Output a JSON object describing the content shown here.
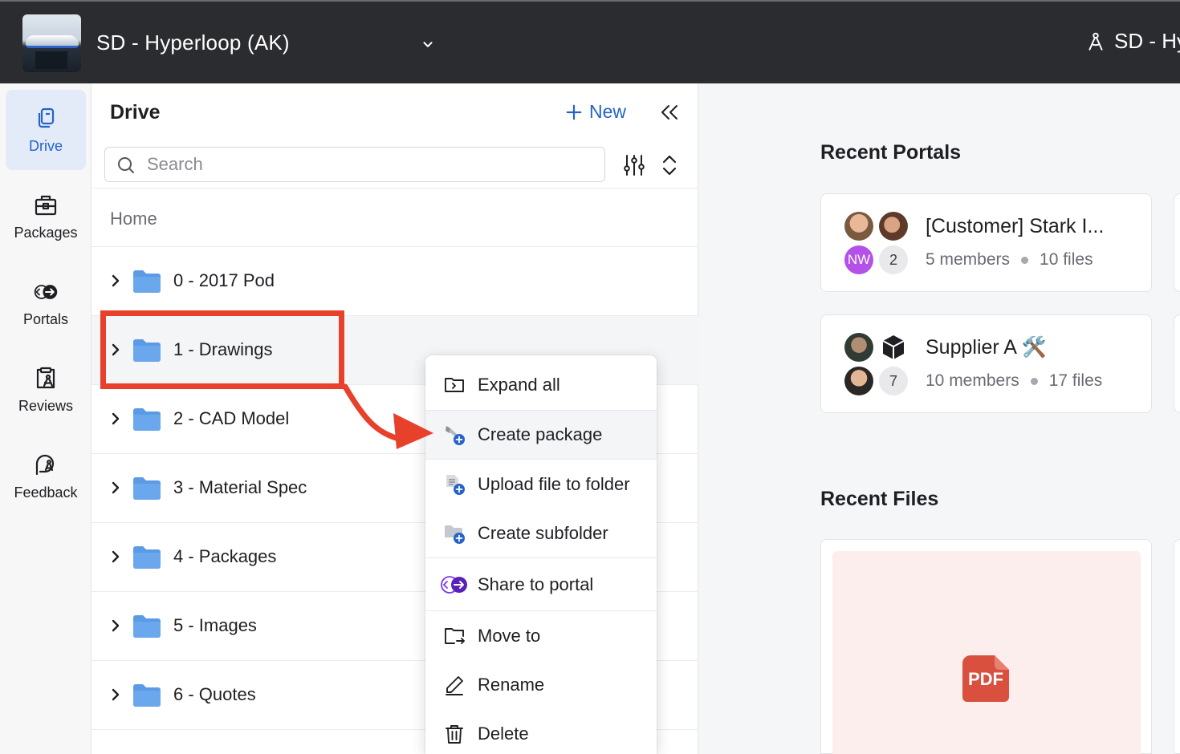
{
  "topbar": {
    "project_title": "SD - Hyperloop (AK)",
    "user_label": "SD - Hy"
  },
  "rail": {
    "items": [
      {
        "label": "Drive",
        "icon": "drive-icon",
        "active": true
      },
      {
        "label": "Packages",
        "icon": "package-icon"
      },
      {
        "label": "Portals",
        "icon": "portal-icon"
      },
      {
        "label": "Reviews",
        "icon": "review-icon"
      },
      {
        "label": "Feedback",
        "icon": "feedback-icon"
      }
    ]
  },
  "drive": {
    "title": "Drive",
    "new_label": "New",
    "search_placeholder": "Search",
    "breadcrumb": "Home",
    "folders": [
      {
        "name": "0 - 2017 Pod"
      },
      {
        "name": "1 - Drawings"
      },
      {
        "name": "2 - CAD Model"
      },
      {
        "name": "3 - Material Spec"
      },
      {
        "name": "4 - Packages"
      },
      {
        "name": "5 - Images"
      },
      {
        "name": "6 - Quotes"
      }
    ]
  },
  "context_menu": {
    "items": [
      {
        "label": "Expand all",
        "icon": "expand-folder-icon"
      },
      {
        "label": "Create package",
        "icon": "create-package-icon"
      },
      {
        "label": "Upload file to folder",
        "icon": "upload-file-icon"
      },
      {
        "label": "Create subfolder",
        "icon": "create-subfolder-icon"
      },
      {
        "label": "Share to portal",
        "icon": "share-portal-icon"
      },
      {
        "label": "Move to",
        "icon": "move-folder-icon"
      },
      {
        "label": "Rename",
        "icon": "pencil-icon"
      },
      {
        "label": "Delete",
        "icon": "trash-icon"
      }
    ]
  },
  "recent_portals": {
    "title": "Recent Portals",
    "cards": [
      {
        "name": "[Customer] Stark I...",
        "members": "5 members",
        "files": "10 files",
        "avatar_initials": "NW",
        "extra_count": "2"
      },
      {
        "name": "Supplier A 🛠️",
        "members": "10 members",
        "files": "17 files",
        "extra_count": "7"
      }
    ]
  },
  "recent_files": {
    "title": "Recent Files",
    "file_type": "PDF"
  },
  "colors": {
    "accent": "#2563c9",
    "annotation": "#e8412b",
    "folder": "#5b9be6",
    "avatar_nw": "#b351e8",
    "pdf": "#d9503f"
  }
}
